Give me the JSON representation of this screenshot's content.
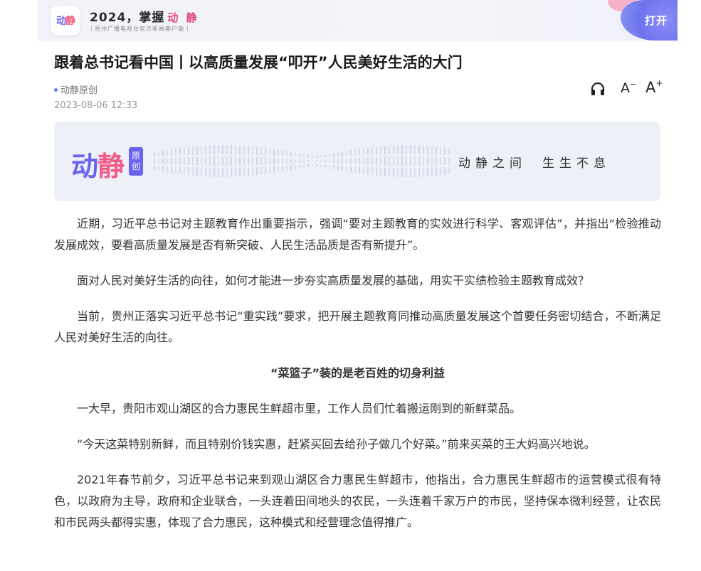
{
  "header": {
    "app_logo_part1": "动",
    "app_logo_part2": "静",
    "slogan_year": "2024，掌握",
    "slogan_brand": "动 静",
    "sub_slogan": "贵州广播电视台官方新闻客户端",
    "open_label": "打开"
  },
  "article": {
    "title": "跟着总书记看中国丨以高质量发展“叩开”人民美好生活的大门",
    "source": "动静原创",
    "timestamp": "2023-08-06 12:33",
    "tools": {
      "listen_icon": "headphone-icon",
      "font_decrease": "A",
      "font_decrease_sign": "−",
      "font_increase": "A",
      "font_increase_sign": "+"
    },
    "banner": {
      "brand_part1": "动",
      "brand_part2": "静",
      "tag_line1": "原",
      "tag_line2": "创",
      "slogan_left": "动静之间",
      "slogan_right": "生生不息"
    },
    "paragraphs": [
      "近期，习近平总书记对主题教育作出重要指示，强调“要对主题教育的实效进行科学、客观评估”，并指出“检验推动发展成效，要看高质量发展是否有新突破、人民生活品质是否有新提升”。",
      "面对人民对美好生活的向往，如何才能进一步夯实高质量发展的基础，用实干实绩检验主题教育成效？",
      "当前，贵州正落实习近平总书记“重实践”要求，把开展主题教育同推动高质量发展这个首要任务密切结合，不断满足人民对美好生活的向往。",
      "一大早，贵阳市观山湖区的合力惠民生鲜超市里，工作人员们忙着搬运刚到的新鲜菜品。",
      "“今天这菜特别新鲜，而且特别价钱实惠，赶紧买回去给孙子做几个好菜。”前来买菜的王大妈高兴地说。",
      "2021年春节前夕，习近平总书记来到观山湖区合力惠民生鲜超市，他指出，合力惠民生鲜超市的运营模式很有特色，以政府为主导，政府和企业联合，一头连着田间地头的农民，一头连着千家万户的市民，坚持保本微利经营，让农民和市民两头都得实惠，体现了合力惠民，这种模式和经营理念值得推广。"
    ],
    "subheading": "“菜篮子”装的是老百姓的切身利益"
  },
  "colors": {
    "brand_purple": "#6a63ee",
    "brand_pink": "#ee5c87",
    "banner_bg": "#eef0f8"
  }
}
